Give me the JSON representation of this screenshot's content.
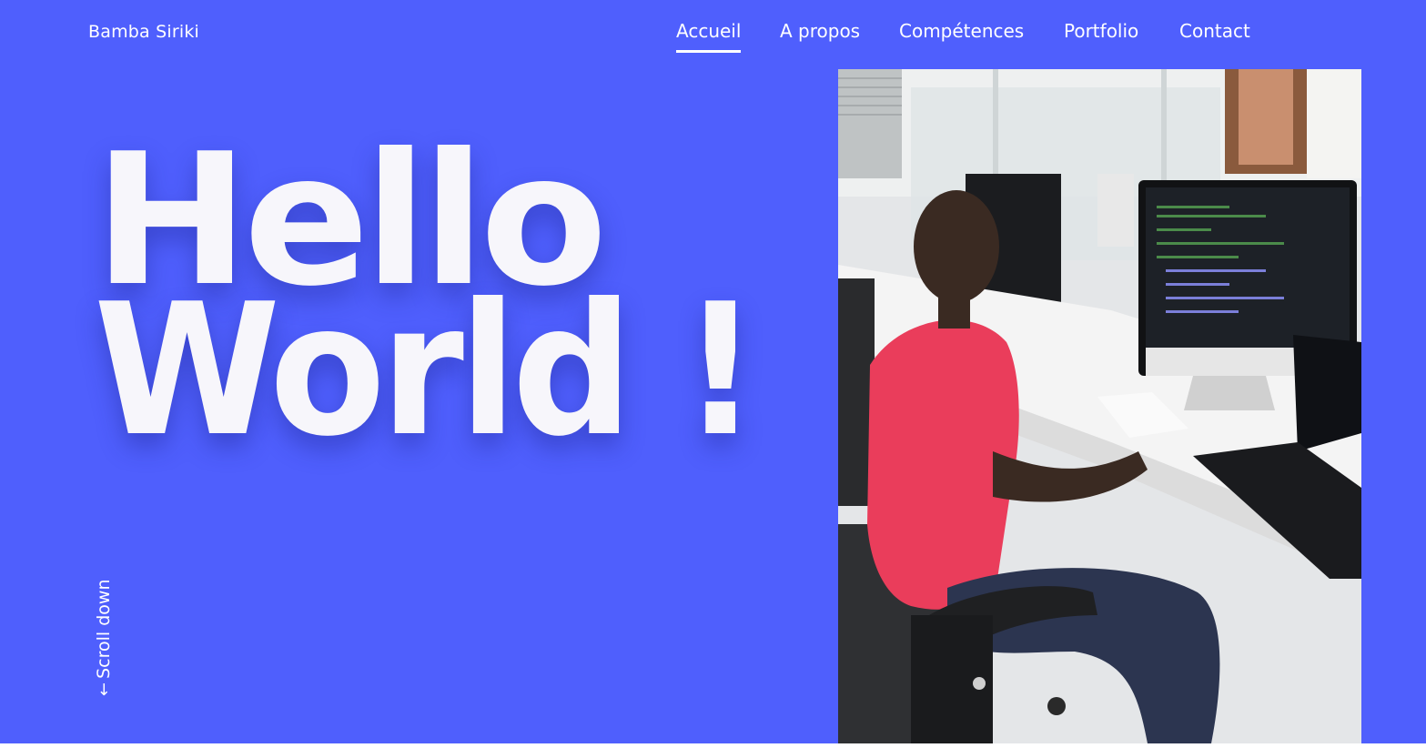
{
  "header": {
    "brand": "Bamba Siriki",
    "nav": [
      {
        "label": "Accueil",
        "active": true
      },
      {
        "label": "A propos",
        "active": false
      },
      {
        "label": "Compétences",
        "active": false
      },
      {
        "label": "Portfolio",
        "active": false
      },
      {
        "label": "Contact",
        "active": false
      }
    ]
  },
  "hero": {
    "line1": "Hello",
    "line2": "World !",
    "scroll_label": "Scroll down",
    "scroll_icon": "arrow-down-icon"
  },
  "photo": {
    "subject": "portrait-photo"
  },
  "colors": {
    "background": "#4f5ffd",
    "text": "#ffffff"
  }
}
